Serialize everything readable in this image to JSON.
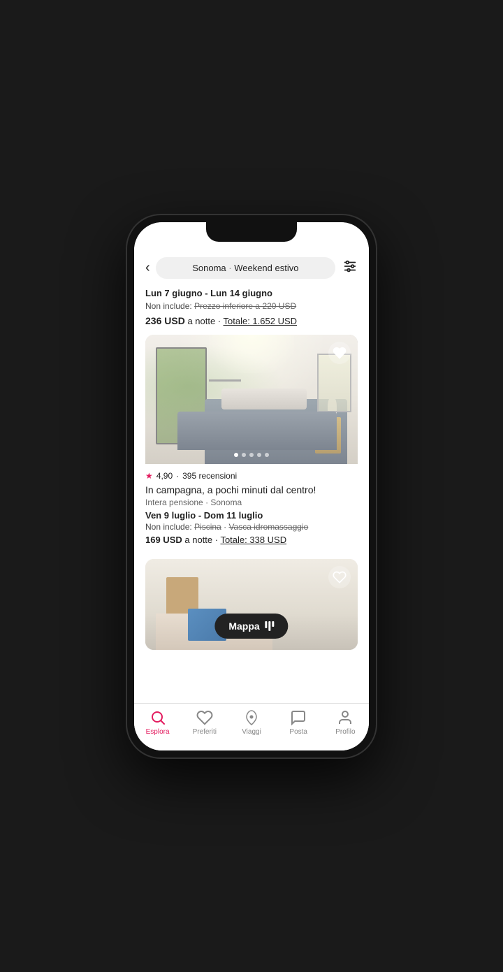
{
  "phone": {
    "header": {
      "back_label": "‹",
      "search_location": "Sonoma",
      "search_separator": "·",
      "search_subtitle": "Weekend estivo",
      "filter_icon": "filter"
    },
    "listing_top": {
      "dates": "Lun 7 giugno - Lun 14 giugno",
      "non_include_label": "Non include:",
      "non_include_value": "Prezzo inferiore a 220 USD",
      "price_amount": "236 USD",
      "price_suffix": "a notte",
      "price_separator": "·",
      "total_label": "Totale: 1.652 USD"
    },
    "listing_card": {
      "image_dots": [
        true,
        false,
        false,
        false,
        false
      ],
      "rating": "4,90",
      "reviews": "395 recensioni",
      "title": "In campagna, a pochi minuti dal centro!",
      "type": "Intera pensione",
      "location": "Sonoma",
      "dates": "Ven 9 luglio - Dom 11 luglio",
      "non_include_label": "Non include:",
      "non_include_items": [
        "Piscina",
        "Vasca idromassaggio"
      ],
      "price_amount": "169 USD",
      "price_suffix": "a notte",
      "price_separator": "·",
      "total_label": "Totale: 338 USD"
    },
    "mappa_button": {
      "label": "Mappa"
    },
    "bottom_nav": {
      "items": [
        {
          "id": "esplora",
          "label": "Esplora",
          "active": true
        },
        {
          "id": "preferiti",
          "label": "Preferiti",
          "active": false
        },
        {
          "id": "viaggi",
          "label": "Viaggi",
          "active": false
        },
        {
          "id": "posta",
          "label": "Posta",
          "active": false
        },
        {
          "id": "profilo",
          "label": "Profilo",
          "active": false
        }
      ]
    }
  }
}
